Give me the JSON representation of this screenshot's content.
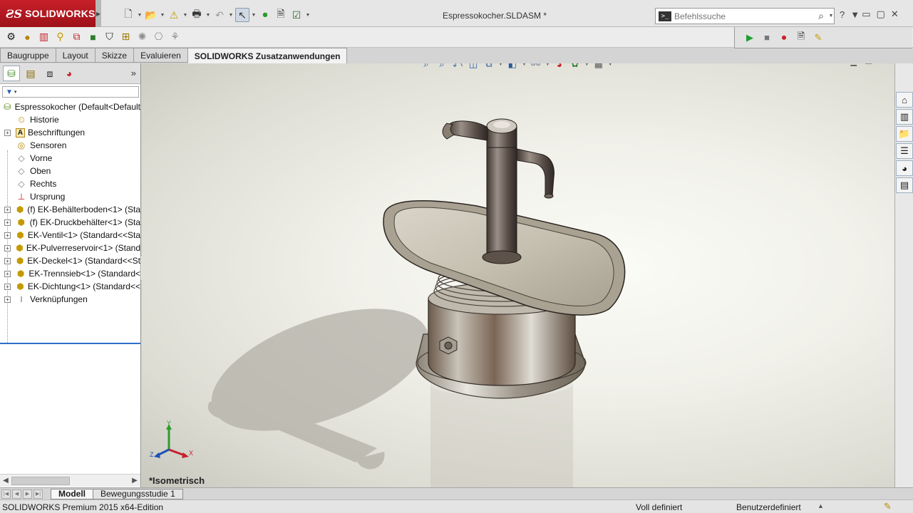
{
  "app": {
    "logo_mark": "ƧS",
    "logo_text": "SOLIDWORKS",
    "document_title": "Espressokocher.SLDASM *"
  },
  "command_search": {
    "placeholder": "Befehlssuche"
  },
  "tabs": [
    {
      "label": "Baugruppe",
      "active": false
    },
    {
      "label": "Layout",
      "active": false
    },
    {
      "label": "Skizze",
      "active": false
    },
    {
      "label": "Evaluieren",
      "active": false
    },
    {
      "label": "SOLIDWORKS Zusatzanwendungen",
      "active": true
    }
  ],
  "tree": {
    "root": "Espressokocher  (Default<Default",
    "items": [
      {
        "label": "Historie",
        "icon": "history-icon",
        "expandable": false
      },
      {
        "label": "Beschriftungen",
        "icon": "annotations-icon",
        "expandable": true
      },
      {
        "label": "Sensoren",
        "icon": "sensor-icon",
        "expandable": false
      },
      {
        "label": "Vorne",
        "icon": "plane-icon",
        "expandable": false
      },
      {
        "label": "Oben",
        "icon": "plane-icon",
        "expandable": false
      },
      {
        "label": "Rechts",
        "icon": "plane-icon",
        "expandable": false
      },
      {
        "label": "Ursprung",
        "icon": "origin-icon",
        "expandable": false
      },
      {
        "label": "(f) EK-Behälterboden<1> (Sta",
        "icon": "part-icon",
        "expandable": true
      },
      {
        "label": "(f) EK-Druckbehälter<1> (Sta",
        "icon": "part-icon",
        "expandable": true
      },
      {
        "label": "EK-Ventil<1> (Standard<<Sta",
        "icon": "part-icon",
        "expandable": true
      },
      {
        "label": "EK-Pulverreservoir<1> (Stand",
        "icon": "part-icon",
        "expandable": true
      },
      {
        "label": "EK-Deckel<1> (Standard<<St",
        "icon": "part-icon",
        "expandable": true
      },
      {
        "label": "EK-Trennsieb<1> (Standard<",
        "icon": "part-icon",
        "expandable": true
      },
      {
        "label": "EK-Dichtung<1> (Standard<<",
        "icon": "part-icon",
        "expandable": true
      },
      {
        "label": "Verknüpfungen",
        "icon": "mates-icon",
        "expandable": true
      }
    ]
  },
  "viewport": {
    "view_name": "*Isometrisch",
    "triad": {
      "x": "X",
      "y": "Y",
      "z": "Z"
    }
  },
  "bottom_tabs": [
    {
      "label": "Modell",
      "active": true
    },
    {
      "label": "Bewegungsstudie 1",
      "active": false
    }
  ],
  "status": {
    "product": "SOLIDWORKS Premium 2015 x64-Edition",
    "definition": "Voll definiert",
    "units": "Benutzerdefiniert"
  },
  "colors": {
    "brand_red": "#c8202a",
    "tree_highlight": "#2f6fc8"
  }
}
